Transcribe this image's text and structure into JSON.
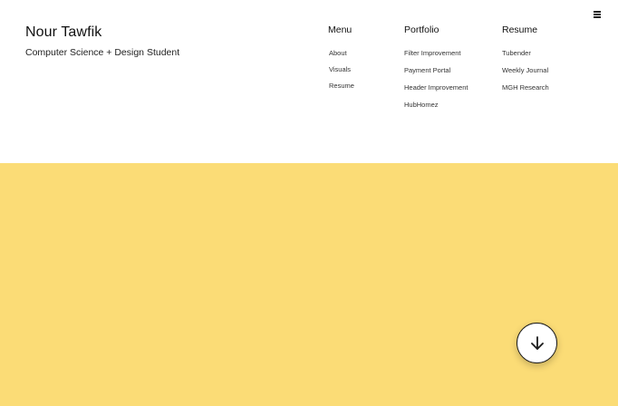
{
  "brand": {
    "name": "Nour Tawfik",
    "tagline": "Computer Science + Design Student"
  },
  "nav": {
    "menu": {
      "heading": "Menu",
      "items": [
        "About",
        "Visuals",
        "Resume"
      ]
    },
    "portfolio": {
      "heading": "Portfolio",
      "items": [
        "Filter Improvement",
        "Payment Portal",
        "Header Improvement",
        "HubHomez"
      ]
    },
    "resume": {
      "heading": "Resume",
      "items": [
        "Tubender",
        "Weekly Journal",
        "MGH Research"
      ]
    }
  },
  "icons": {
    "menu_toggle": "hamburger-icon",
    "scroll_down": "arrow-down-icon"
  },
  "colors": {
    "hero_background": "#fbdc76",
    "page_background": "#ffffff",
    "text": "#1a1a1a"
  }
}
